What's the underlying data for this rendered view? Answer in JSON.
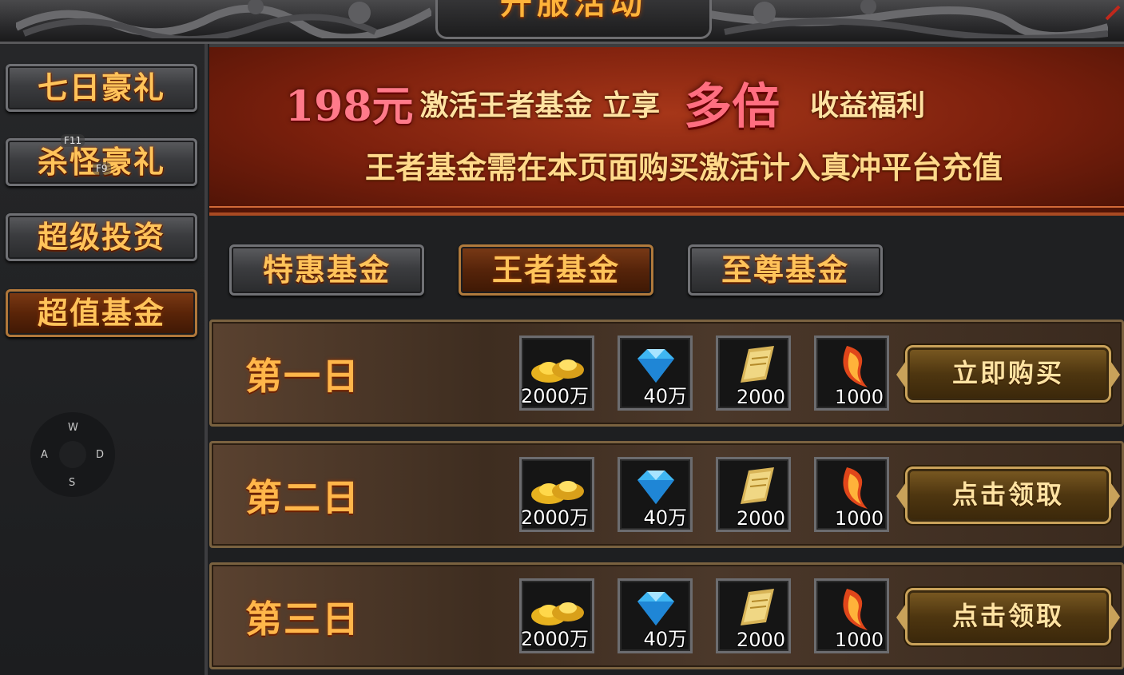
{
  "title": "开服活动",
  "sidebar": {
    "items": [
      {
        "label": "七日豪礼",
        "active": false
      },
      {
        "label": "杀怪豪礼",
        "active": false
      },
      {
        "label": "超级投资",
        "active": false
      },
      {
        "label": "超值基金",
        "active": true
      }
    ],
    "hotkeys": [
      "F11",
      "F9"
    ],
    "wasd": {
      "up": "W",
      "left": "A",
      "right": "D",
      "down": "S"
    }
  },
  "banner": {
    "price": "198元",
    "text_a": "激活王者基金 立享",
    "multiplier": "多倍",
    "text_b": "收益福利",
    "line2": "王者基金需在本页面购买激活计入真冲平台充值"
  },
  "tabs": [
    {
      "label": "特惠基金",
      "active": false
    },
    {
      "label": "王者基金",
      "active": true
    },
    {
      "label": "至尊基金",
      "active": false
    }
  ],
  "rows": [
    {
      "day": "第一日",
      "rewards": [
        {
          "icon": "gold-ingot-icon",
          "amount": "2000万"
        },
        {
          "icon": "diamond-icon",
          "amount": "40万"
        },
        {
          "icon": "scroll-icon",
          "amount": "2000"
        },
        {
          "icon": "flame-feather-icon",
          "amount": "1000"
        }
      ],
      "button": "立即购买"
    },
    {
      "day": "第二日",
      "rewards": [
        {
          "icon": "gold-ingot-icon",
          "amount": "2000万"
        },
        {
          "icon": "diamond-icon",
          "amount": "40万"
        },
        {
          "icon": "scroll-icon",
          "amount": "2000"
        },
        {
          "icon": "flame-feather-icon",
          "amount": "1000"
        }
      ],
      "button": "点击领取"
    },
    {
      "day": "第三日",
      "rewards": [
        {
          "icon": "gold-ingot-icon",
          "amount": "2000万"
        },
        {
          "icon": "diamond-icon",
          "amount": "40万"
        },
        {
          "icon": "scroll-icon",
          "amount": "2000"
        },
        {
          "icon": "flame-feather-icon",
          "amount": "1000"
        }
      ],
      "button": "点击领取"
    }
  ],
  "colors": {
    "accent_gold": "#ffc35a",
    "banner_red": "#7c200d",
    "price_pink": "#ff7a8a"
  }
}
